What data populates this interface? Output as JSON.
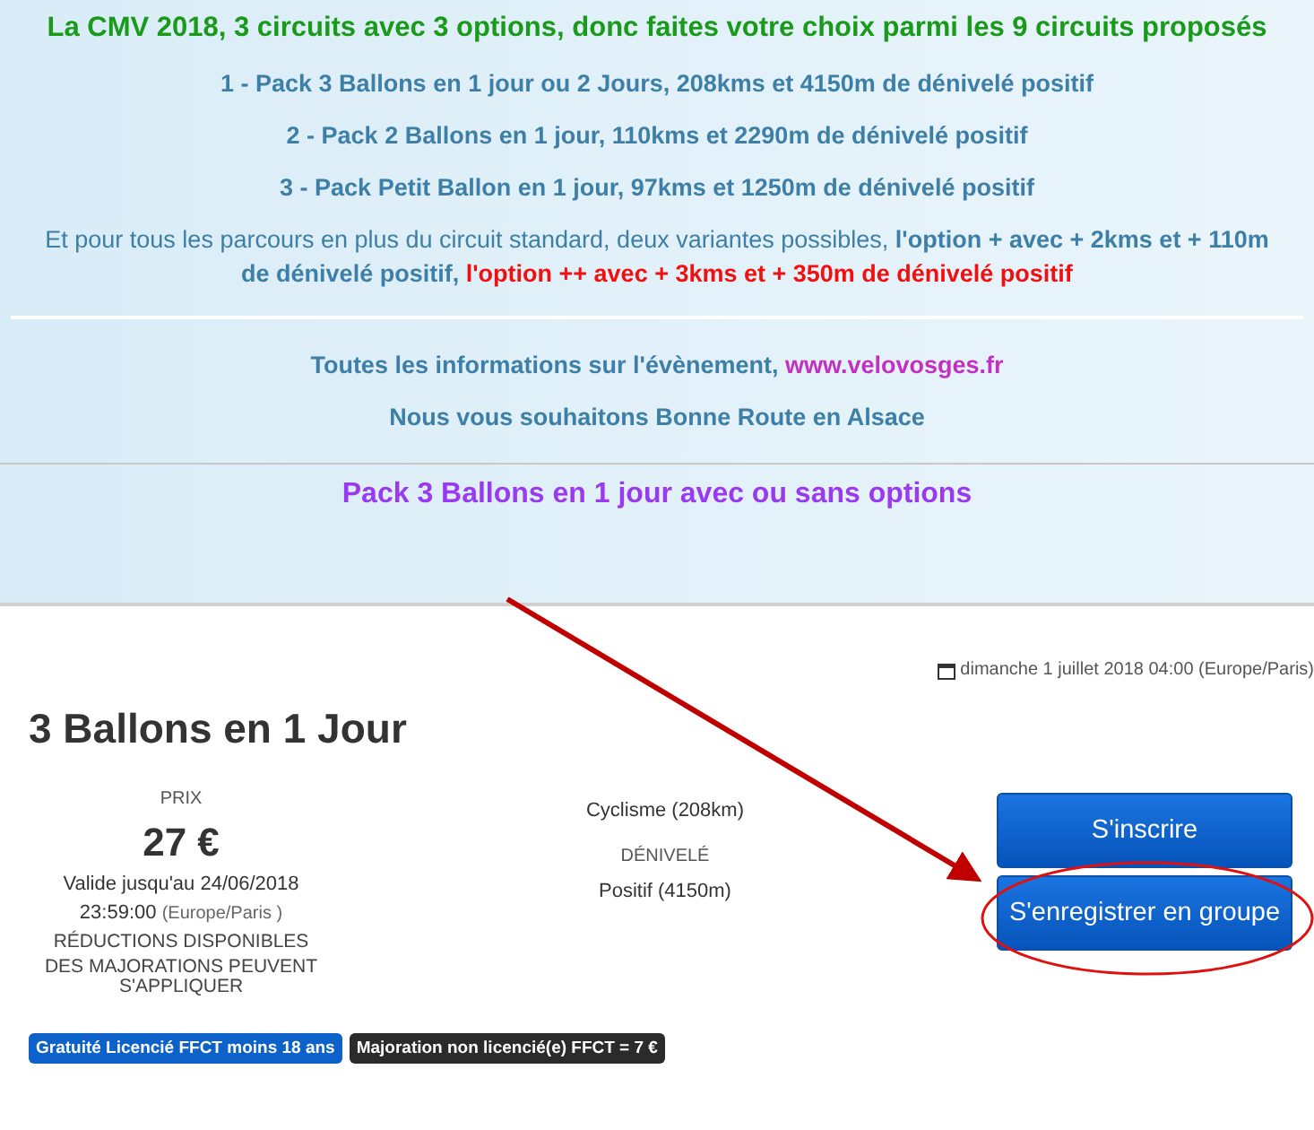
{
  "intro": {
    "headline": "La CMV 2018, 3 circuits avec 3 options, donc faites votre choix parmi les 9 circuits proposés",
    "circuits": [
      "1 - Pack 3 Ballons en 1 jour ou 2 Jours, 208kms et 4150m de dénivelé positif",
      "2 - Pack 2 Ballons en 1 jour, 110kms et 2290m de dénivelé positif",
      "3 - Pack Petit Ballon en 1 jour, 97kms et 1250m de dénivelé positif"
    ],
    "options_note": [
      {
        "kind": "plain",
        "text": "Et pour tous les parcours en plus du circuit standard, deux variantes possibles, "
      },
      {
        "kind": "emphasis",
        "text": "l'option +  avec + 2kms et + 110m de dénivelé positif, "
      },
      {
        "kind": "warning",
        "text": "l'option ++ avec + 3kms et + 350m de dénivelé positif"
      }
    ],
    "info": {
      "text": "Toutes les informations sur l'évènement, ",
      "link": "www.velovosges.fr"
    },
    "greeting": "Nous vous souhaitons Bonne Route en Alsace"
  },
  "section_title": "Pack 3 Ballons en 1 jour avec ou sans options",
  "event": {
    "date": "dimanche 1 juillet 2018 04:00 (Europe/Paris)",
    "title": "3 Ballons en 1 Jour",
    "price_label": "PRIX",
    "price": "27 €",
    "valid_until": "Valide jusqu'au 24/06/2018",
    "valid_time": "23:59:00",
    "valid_zone": "(Europe/Paris )",
    "reductions": "RÉDUCTIONS DISPONIBLES",
    "surcharges": "DES MAJORATIONS PEUVENT S'APPLIQUER",
    "activity": "Cyclisme (208km)",
    "elevation_label": "DÉNIVELÉ",
    "elevation": "Positif (4150m)",
    "buttons": [
      "S'inscrire",
      "S'enregistrer en groupe"
    ],
    "tags": [
      {
        "label": "Gratuité Licencié FFCT moins 18 ans",
        "color": "#0d62c9"
      },
      {
        "label": "Majoration non licencié(e) FFCT = 7 €",
        "color": "#2b2b2b"
      }
    ]
  }
}
